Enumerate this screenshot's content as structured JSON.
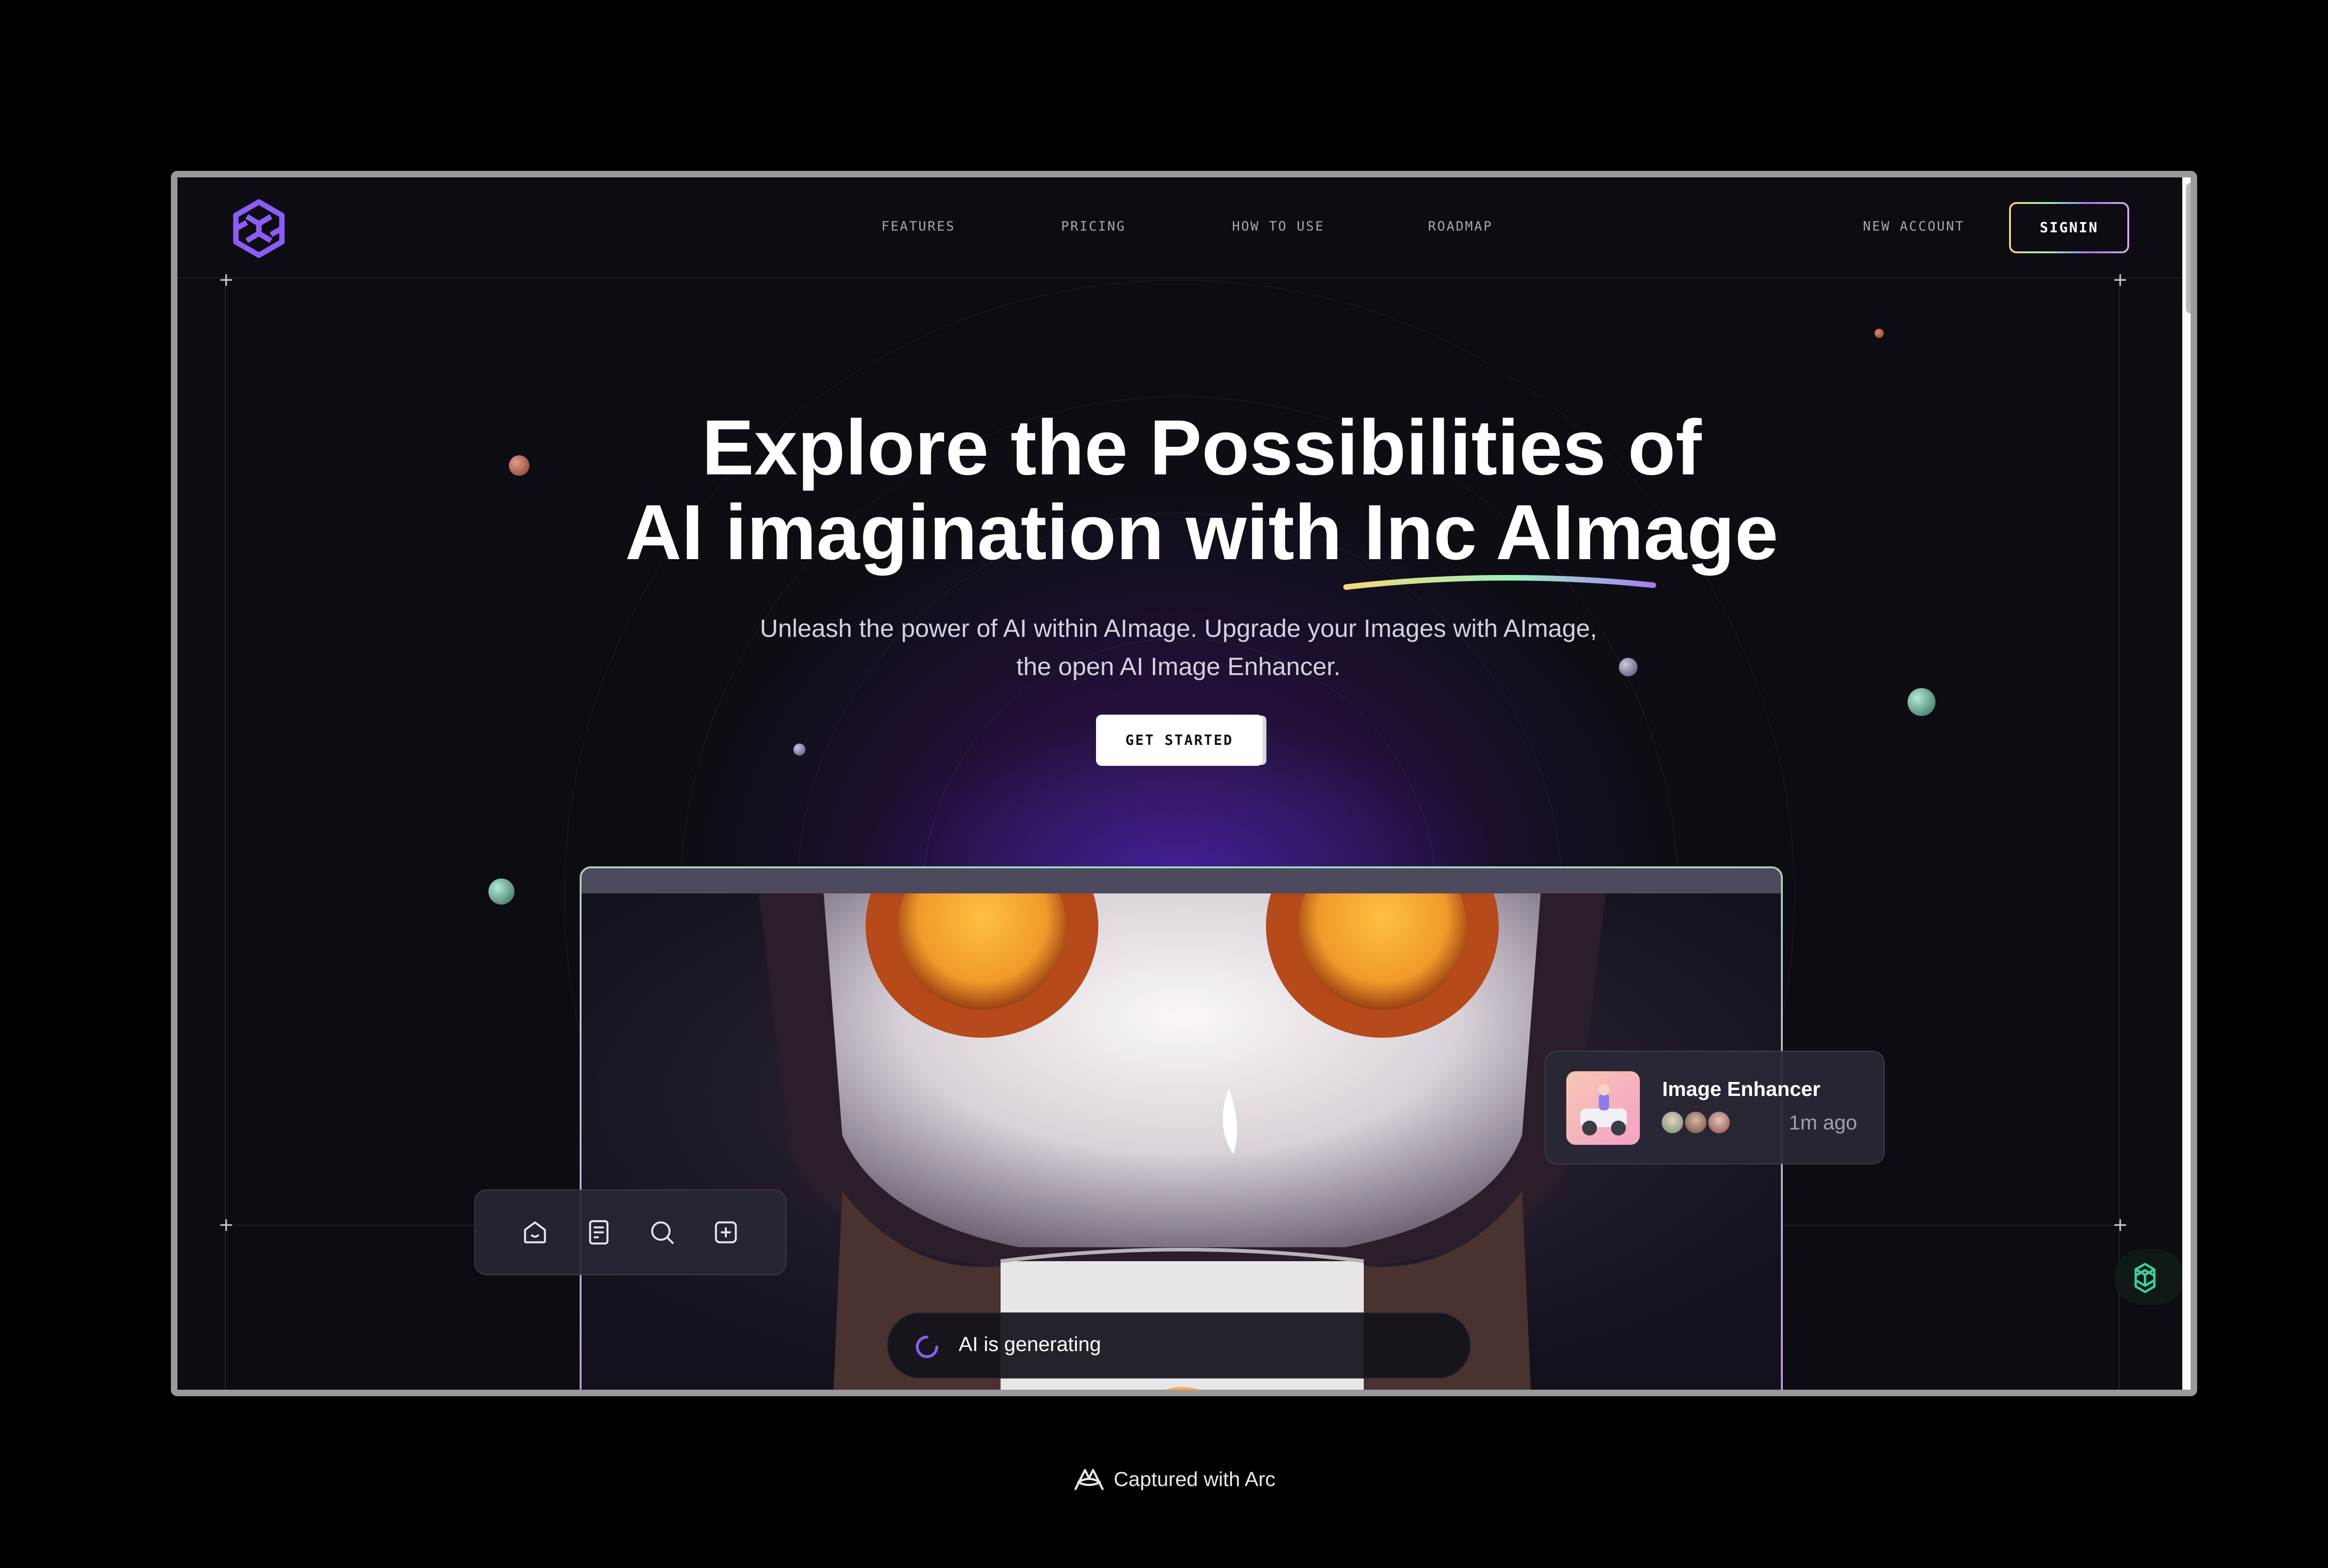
{
  "nav": {
    "items": [
      {
        "label": "FEATURES"
      },
      {
        "label": "PRICING"
      },
      {
        "label": "HOW TO USE"
      },
      {
        "label": "ROADMAP"
      }
    ],
    "new_account": "NEW ACCOUNT",
    "signin": "SIGNIN"
  },
  "hero": {
    "title_line1": "Explore the Possibilities of",
    "title_line2_prefix": "AI imagination with ",
    "title_line2_highlight": "Inc AImage",
    "subtitle_line1": "Unleash the power of AI within AImage. Upgrade your Images with AImage,",
    "subtitle_line2": "the open AI Image Enhancer.",
    "cta": "GET STARTED"
  },
  "preview": {
    "toolbar_icons": [
      "home-icon",
      "document-icon",
      "search-icon",
      "add-icon"
    ],
    "card": {
      "title": "Image Enhancer",
      "time": "1m ago"
    },
    "status": "AI is generating"
  },
  "colors": {
    "background": "#0d0c12",
    "accent_purple": "#8b5cf6",
    "highlight_gradient": [
      "#f6d77a",
      "#9cf0c0",
      "#a87cf0"
    ]
  },
  "footer": {
    "caption": "Captured with Arc"
  }
}
